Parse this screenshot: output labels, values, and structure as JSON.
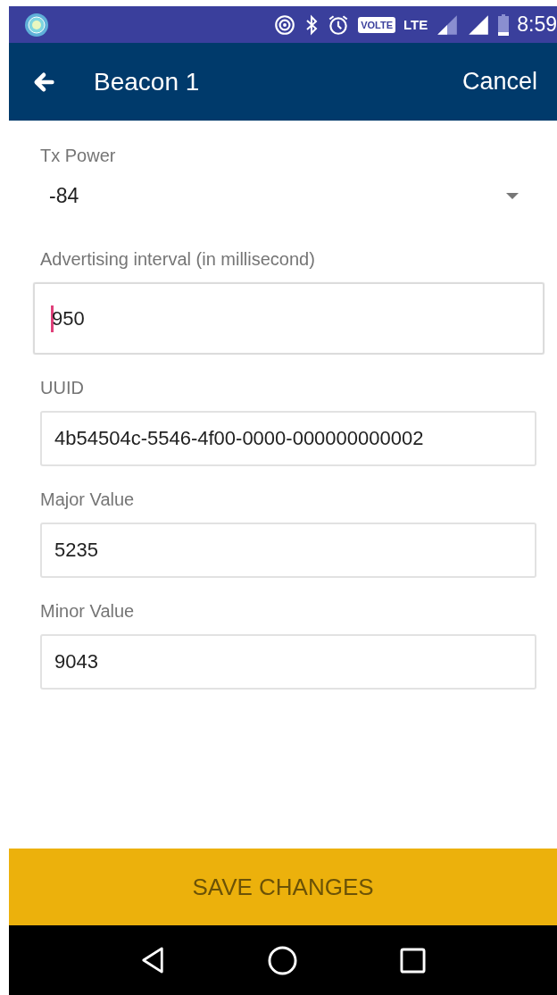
{
  "status_bar": {
    "volte": "VOLTE",
    "network": "LTE",
    "time": "8:59"
  },
  "app_bar": {
    "title": "Beacon 1",
    "action": "Cancel"
  },
  "tx_power": {
    "label": "Tx Power",
    "value": "-84"
  },
  "fields": [
    {
      "label": "Advertising interval (in millisecond)",
      "value": "950",
      "focused": true
    },
    {
      "label": "UUID",
      "value": "4b54504c-5546-4f00-0000-000000000002",
      "focused": false
    },
    {
      "label": "Major Value",
      "value": "5235",
      "focused": false
    },
    {
      "label": "Minor Value",
      "value": "9043",
      "focused": false
    }
  ],
  "save_button": "SAVE CHANGES"
}
